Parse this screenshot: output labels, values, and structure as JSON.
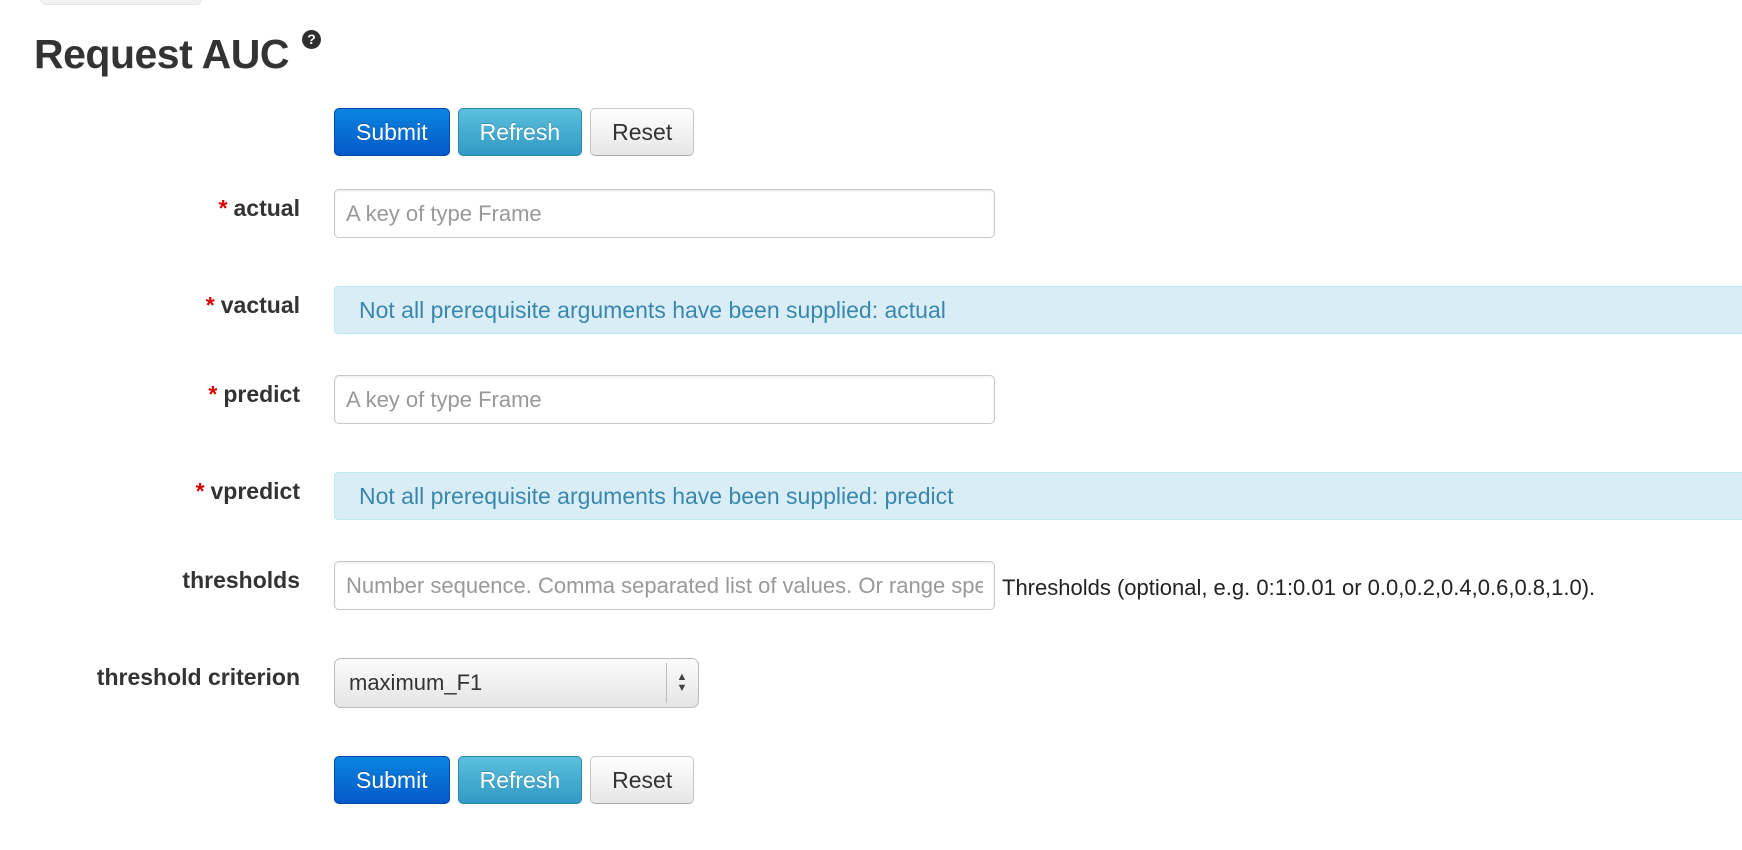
{
  "page": {
    "title": "Request AUC",
    "help_icon_glyph": "?"
  },
  "buttons": {
    "submit_label": "Submit",
    "refresh_label": "Refresh",
    "reset_label": "Reset"
  },
  "form": {
    "required_marker": "*",
    "actual": {
      "label": "actual",
      "placeholder": "A key of type Frame",
      "value": ""
    },
    "vactual": {
      "label": "vactual",
      "message": "Not all prerequisite arguments have been supplied: actual"
    },
    "predict": {
      "label": "predict",
      "placeholder": "A key of type Frame",
      "value": ""
    },
    "vpredict": {
      "label": "vpredict",
      "message": "Not all prerequisite arguments have been supplied: predict"
    },
    "thresholds": {
      "label": "thresholds",
      "placeholder": "Number sequence. Comma separated list of values. Or range specification",
      "help": "Thresholds (optional, e.g. 0:1:0.01 or 0.0,0.2,0.4,0.6,0.8,1.0)."
    },
    "threshold_criterion": {
      "label": "threshold criterion",
      "selected": "maximum_F1",
      "arrow_up": "▲",
      "arrow_down": "▼"
    }
  },
  "colors": {
    "primary": "#0459c9",
    "info": "#3199c3",
    "info_box_bg": "#d9edf7",
    "info_box_text": "#3a87ad",
    "required": "#d80000"
  }
}
